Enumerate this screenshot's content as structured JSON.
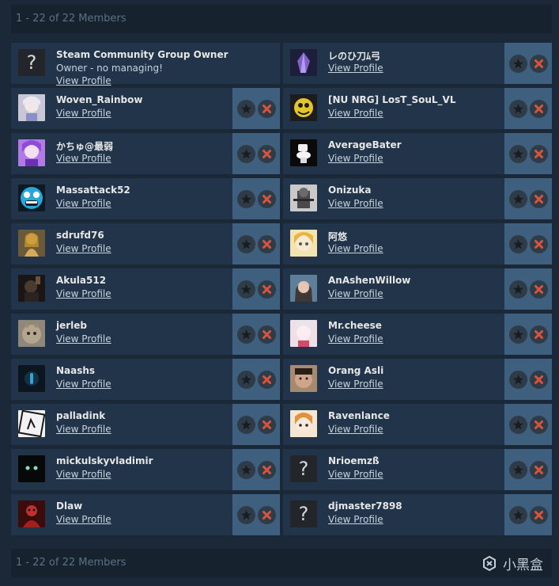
{
  "members_count": "1 - 22 of 22 Members",
  "view_profile_label": "View Profile",
  "watermark": "小黑盒",
  "colors": {
    "page_bg": "#1b2838",
    "card_bg": "#213449",
    "actions_bg": "#3e5f7e",
    "remove_x": "#d9543f"
  },
  "owner": {
    "name": "Steam Community Group Owner",
    "subtitle": "Owner - no managing!",
    "avatar": "unknown"
  },
  "members": [
    {
      "name": "レのひ刀ﾑ弓",
      "avatar": "crystal",
      "column": "right"
    },
    {
      "name": "Woven_Rainbow",
      "avatar": "anime-girl-white",
      "column": "left"
    },
    {
      "name": "[NU NRG] LosT_SouL_VL",
      "avatar": "yellow-creature",
      "column": "right"
    },
    {
      "name": "かちゅ@最弱",
      "avatar": "anime-purple",
      "column": "left"
    },
    {
      "name": "AverageBater",
      "avatar": "toilet",
      "column": "right"
    },
    {
      "name": "Massattack52",
      "avatar": "blue-face",
      "column": "left"
    },
    {
      "name": "Onizuka",
      "avatar": "soldier",
      "column": "right"
    },
    {
      "name": "sdrufd76",
      "avatar": "golden-figure",
      "column": "left"
    },
    {
      "name": "阿悠",
      "avatar": "anime-blonde",
      "column": "right"
    },
    {
      "name": "Akula512",
      "avatar": "dark-portrait",
      "column": "left"
    },
    {
      "name": "AnAshenWillow",
      "avatar": "woman-portrait",
      "column": "right"
    },
    {
      "name": "jerleb",
      "avatar": "cat",
      "column": "left"
    },
    {
      "name": "Mr.cheese",
      "avatar": "anime-pink",
      "column": "right"
    },
    {
      "name": "Naashs",
      "avatar": "blue-glow",
      "column": "left"
    },
    {
      "name": "Orang Asli",
      "avatar": "man-face",
      "column": "right"
    },
    {
      "name": "palladink",
      "avatar": "sketch-frame",
      "column": "left"
    },
    {
      "name": "Ravenlance",
      "avatar": "anime-fox",
      "column": "right"
    },
    {
      "name": "mickulskyvladimir",
      "avatar": "dark-eyes",
      "column": "left"
    },
    {
      "name": "Nrioemzß",
      "avatar": "unknown",
      "column": "right"
    },
    {
      "name": "Dlaw",
      "avatar": "red-figure",
      "column": "left"
    },
    {
      "name": "djmaster7898",
      "avatar": "unknown",
      "column": "right"
    }
  ]
}
